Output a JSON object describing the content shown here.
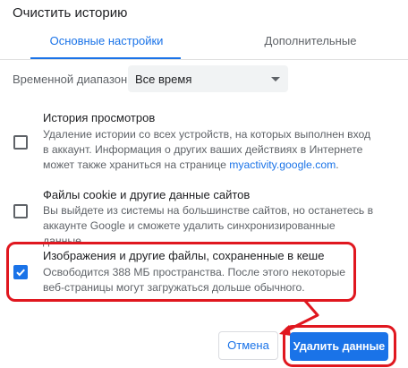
{
  "dialog": {
    "title": "Очистить историю"
  },
  "tabs": [
    {
      "label": "Основные настройки",
      "active": true
    },
    {
      "label": "Дополнительные",
      "active": false
    }
  ],
  "time_range": {
    "label": "Временной диапазон",
    "value": "Все время"
  },
  "items": [
    {
      "title": "История просмотров",
      "desc_before_link": "Удаление истории со всех устройств, на которых выполнен вход в аккаунт. Информация о других ваших действиях в Интернете может также храниться на странице ",
      "link": "myactivity.google.com",
      "desc_after_link": ".",
      "checked": false
    },
    {
      "title": "Файлы cookie и другие данные сайтов",
      "desc": "Вы выйдете из системы на большинстве сайтов, но останетесь в аккаунте Google и сможете удалить синхронизированные данные.",
      "checked": false
    },
    {
      "title": "Изображения и другие файлы, сохраненные в кеше",
      "desc": "Освободится 388 МБ пространства. После этого некоторые веб-страницы могут загружаться дольше обычного.",
      "checked": true
    }
  ],
  "buttons": {
    "cancel": "Отмена",
    "delete": "Удалить данные"
  },
  "colors": {
    "accent": "#1a73e8",
    "highlight": "#e0171f"
  }
}
